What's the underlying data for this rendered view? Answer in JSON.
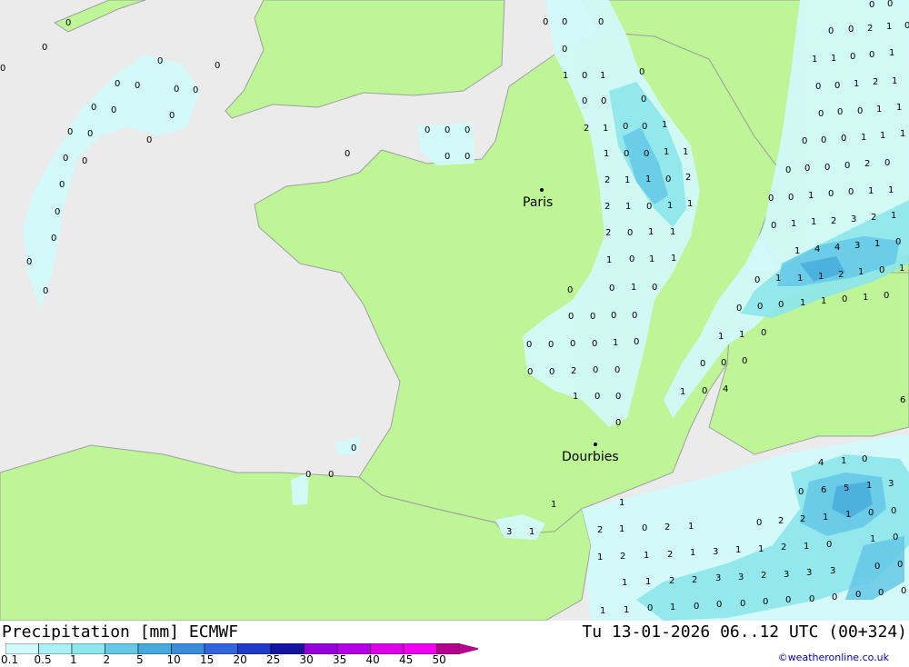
{
  "title": "Precipitation [mm] ECMWF",
  "run_info": "Tu 13-01-2026 06..12 UTC (00+324)",
  "credit": "©weatheronline.co.uk",
  "colors": {
    "land": "#bef596",
    "sea": "#ebebeb",
    "border": "#a0a0a0",
    "p01": "#d2fafa",
    "p05": "#aaf0f5",
    "p1": "#8ce6eb",
    "p2": "#64c8e6",
    "p5": "#46aadc"
  },
  "legend": {
    "labels": [
      "0.1",
      "0.5",
      "1",
      "2",
      "5",
      "10",
      "15",
      "20",
      "25",
      "30",
      "35",
      "40",
      "45",
      "50"
    ],
    "colors": [
      "#d2fafa",
      "#aaf0f5",
      "#8ce6eb",
      "#64c8e6",
      "#46aadc",
      "#3c8cdc",
      "#3264dc",
      "#1e3cc8",
      "#1414a0",
      "#9600dc",
      "#b400e6",
      "#dc00e6",
      "#f000f0",
      "#b4008c"
    ]
  },
  "cities": [
    {
      "name": "Paris"
    },
    {
      "name": "Dourbies"
    }
  ],
  "values": [
    "0",
    "0",
    "0",
    "0",
    "0",
    "0",
    "0",
    "0",
    "0",
    "0",
    "0",
    "0",
    "0",
    "0",
    "0",
    "0",
    "0",
    "0",
    "0",
    "0",
    "0",
    "0",
    "0",
    "0",
    "0",
    "0",
    "0",
    "0",
    "0",
    "0",
    "0",
    "0",
    "1",
    "0",
    "1",
    "0",
    "0",
    "0",
    "0",
    "2",
    "1",
    "0",
    "0",
    "1",
    "1",
    "0",
    "0",
    "1",
    "1",
    "2",
    "1",
    "1",
    "0",
    "2",
    "2",
    "1",
    "0",
    "1",
    "1",
    "2",
    "0",
    "1",
    "1",
    "1",
    "0",
    "1",
    "1",
    "0",
    "0",
    "1",
    "0",
    "0",
    "0",
    "0",
    "0",
    "0",
    "0",
    "0",
    "0",
    "1",
    "0",
    "0",
    "0",
    "2",
    "0",
    "0",
    "1",
    "0",
    "0",
    "0",
    "0",
    "0",
    "2",
    "1",
    "0",
    "0",
    "0",
    "1",
    "1",
    "0",
    "0",
    "1",
    "0",
    "0",
    "1",
    "2",
    "1",
    "0",
    "0",
    "0",
    "1",
    "1",
    "0",
    "0",
    "0",
    "1",
    "1",
    "1",
    "0",
    "0",
    "0",
    "0",
    "2",
    "0",
    "0",
    "0",
    "1",
    "0",
    "0",
    "1",
    "1",
    "0",
    "1",
    "1",
    "2",
    "3",
    "2",
    "1",
    "1",
    "4",
    "4",
    "3",
    "1",
    "0",
    "1",
    "1",
    "2",
    "1",
    "0",
    "1",
    "0",
    "1",
    "0",
    "0",
    "0",
    "1",
    "1",
    "0",
    "1",
    "0",
    "1",
    "1",
    "0",
    "0",
    "0",
    "0",
    "1",
    "0",
    "4",
    "6",
    "4",
    "1",
    "0",
    "0",
    "6",
    "5",
    "1",
    "3",
    "0",
    "2",
    "2",
    "1",
    "1",
    "0",
    "0",
    "1",
    "0",
    "2",
    "1",
    "0",
    "2",
    "1",
    "1",
    "1",
    "3",
    "1",
    "1",
    "2",
    "1",
    "2",
    "1",
    "3",
    "1",
    "1",
    "2",
    "1",
    "0",
    "1",
    "1",
    "2",
    "2",
    "3",
    "3",
    "2",
    "3",
    "3",
    "3",
    "0",
    "0",
    "1",
    "1",
    "0",
    "1",
    "0",
    "0",
    "0",
    "0",
    "0",
    "0",
    "0",
    "0",
    "0",
    "0",
    "0",
    "0",
    "0",
    "0"
  ]
}
